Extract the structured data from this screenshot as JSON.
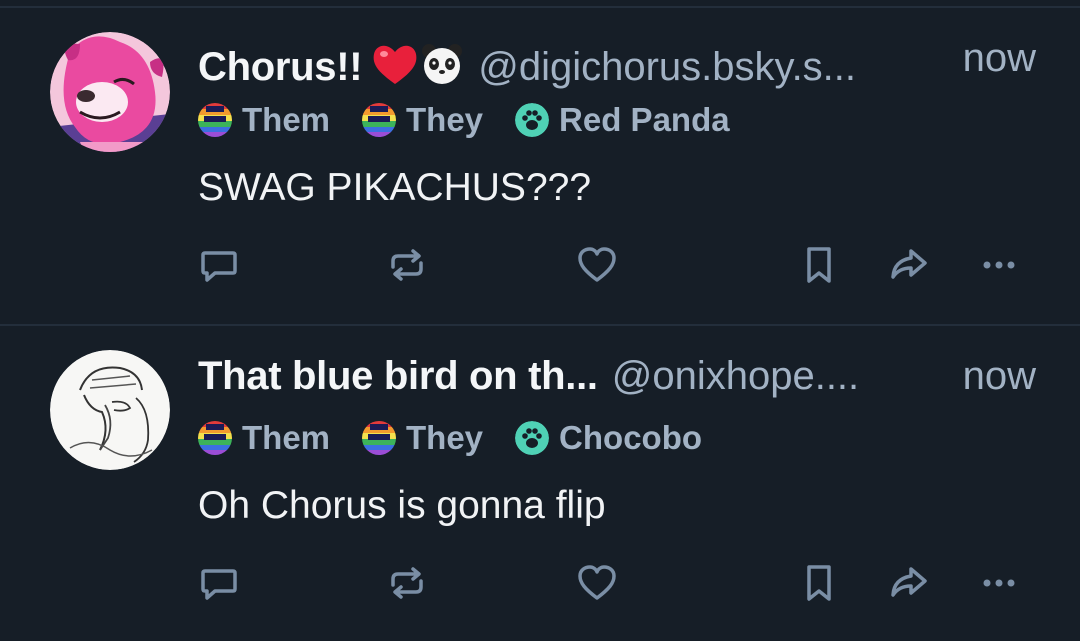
{
  "posts": [
    {
      "display_name": "Chorus!!",
      "name_emoji": [
        "red-heart-emoji",
        "panda-emoji"
      ],
      "handle": "@digichorus.bsky.s...",
      "time": "now",
      "pronouns": [
        "Them",
        "They"
      ],
      "species": "Red Panda",
      "text": "SWAG PIKACHUS???",
      "avatar": "pink-red-panda-avatar"
    },
    {
      "display_name": "That blue bird on th...",
      "handle": "@onixhope....",
      "time": "now",
      "pronouns": [
        "Them",
        "They"
      ],
      "species": "Chocobo",
      "text": "Oh Chorus is gonna flip",
      "avatar": "sketched-bird-avatar"
    }
  ],
  "actions": [
    "reply-icon",
    "repost-icon",
    "like-icon",
    "bookmark-icon",
    "share-icon",
    "more-icon"
  ],
  "colors": {
    "background": "#161e27",
    "divider": "#232e3b",
    "text_primary": "#f1f3f5",
    "text_secondary": "#a2b2c4",
    "species_badge": "#4fd1b5",
    "heart": "#e8203b"
  }
}
